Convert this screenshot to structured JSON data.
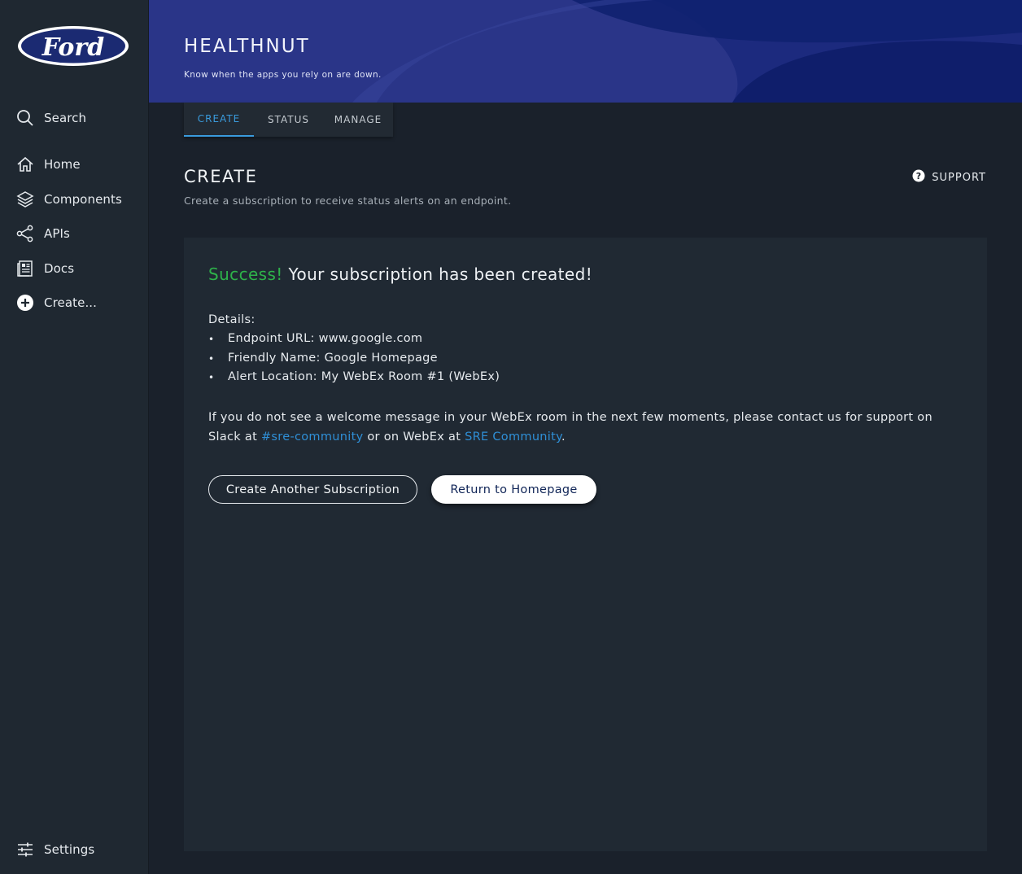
{
  "brand": {
    "logo_text": "Ford"
  },
  "sidebar": {
    "items": [
      {
        "label": "Search",
        "icon": "search-icon"
      },
      {
        "label": "Home",
        "icon": "home-icon"
      },
      {
        "label": "Components",
        "icon": "layers-icon"
      },
      {
        "label": "APIs",
        "icon": "share-icon"
      },
      {
        "label": "Docs",
        "icon": "docs-icon"
      },
      {
        "label": "Create...",
        "icon": "plus-circle-icon"
      }
    ],
    "settings": {
      "label": "Settings",
      "icon": "sliders-icon"
    }
  },
  "header": {
    "title": "HEALTHNUT",
    "subtitle": "Know when the apps you rely on are down."
  },
  "tabs": [
    {
      "label": "CREATE",
      "active": true
    },
    {
      "label": "STATUS",
      "active": false
    },
    {
      "label": "MANAGE",
      "active": false
    }
  ],
  "section": {
    "title": "CREATE",
    "subtitle": "Create a subscription to receive status alerts on an endpoint.",
    "support_label": "SUPPORT"
  },
  "result": {
    "success_word": "Success!",
    "success_text": " Your subscription has been created!",
    "details_label": "Details:",
    "details": [
      "Endpoint URL: www.google.com",
      "Friendly Name: Google Homepage",
      "Alert Location: My WebEx Room #1 (WebEx)"
    ],
    "message_part1": "If you do not see a welcome message in your WebEx room in the next few moments, please contact us for support on Slack at ",
    "slack_link": "#sre-community",
    "message_part2": " or on WebEx at ",
    "webex_link": "SRE Community",
    "message_part3": "."
  },
  "buttons": {
    "create_another": "Create Another Subscription",
    "return_home": "Return to Homepage"
  },
  "colors": {
    "accent": "#3a9bdc",
    "success": "#2eb24a",
    "header_bg": "#26307a"
  }
}
